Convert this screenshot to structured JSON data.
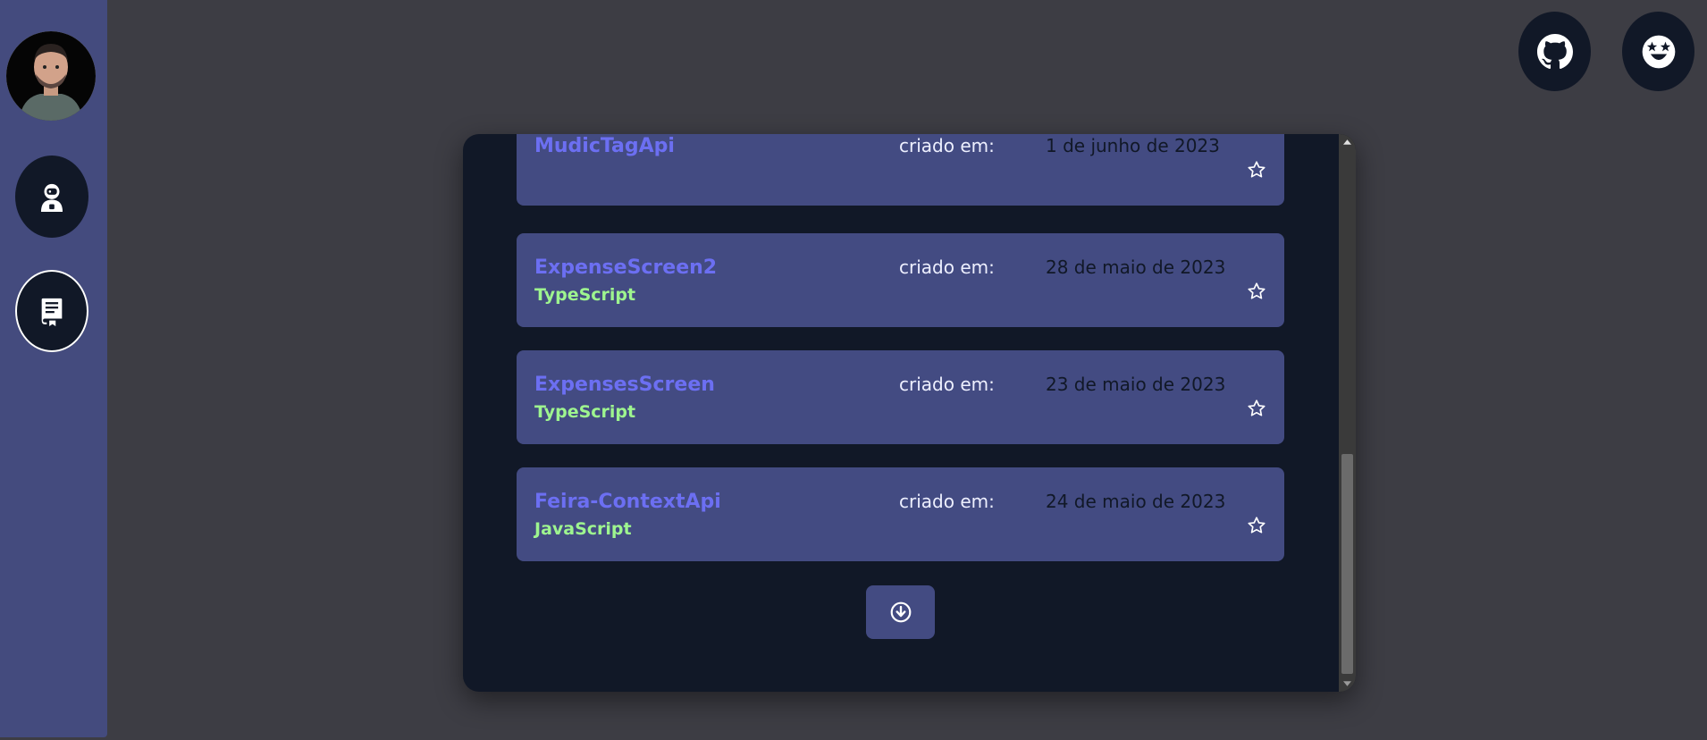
{
  "sidebar": {
    "items": [
      {
        "icon": "astronaut-icon"
      },
      {
        "icon": "repository-book-icon",
        "active": true
      }
    ]
  },
  "header": {
    "actions": [
      {
        "icon": "github-icon"
      },
      {
        "icon": "star-struck-emoji-icon"
      }
    ]
  },
  "repos": [
    {
      "name": "MudicTagApi",
      "language": "",
      "created_label": "criado em:",
      "created": "1 de junho de 2023"
    },
    {
      "name": "ExpenseScreen2",
      "language": "TypeScript",
      "created_label": "criado em:",
      "created": "28 de maio de 2023"
    },
    {
      "name": "ExpensesScreen",
      "language": "TypeScript",
      "created_label": "criado em:",
      "created": "23 de maio de 2023"
    },
    {
      "name": "Feira-ContextApi",
      "language": "JavaScript",
      "created_label": "criado em:",
      "created": "24 de maio de 2023"
    }
  ],
  "load_more": {
    "icon": "arrow-down-circle-icon"
  },
  "colors": {
    "background": "#3d3d44",
    "sidebar": "#444b7e",
    "panel": "#111827",
    "card": "#434b82",
    "repo_name": "#6c6ff2",
    "language": "#9ef58f"
  }
}
